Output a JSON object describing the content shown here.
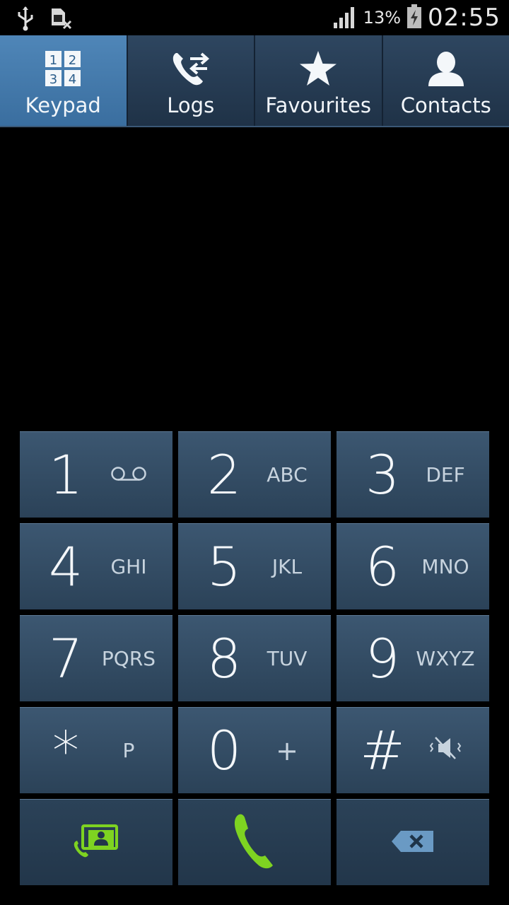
{
  "status_bar": {
    "battery": "13%",
    "time": "02:55",
    "icons": [
      "usb-icon",
      "sim-missing-icon",
      "signal-icon",
      "battery-charging-icon"
    ]
  },
  "tabs": [
    {
      "label": "Keypad",
      "icon": "keypad-icon",
      "active": true
    },
    {
      "label": "Logs",
      "icon": "call-logs-icon",
      "active": false
    },
    {
      "label": "Favourites",
      "icon": "star-icon",
      "active": false
    },
    {
      "label": "Contacts",
      "icon": "contact-icon",
      "active": false
    }
  ],
  "keypad_icon_digits": [
    "1",
    "2",
    "3",
    "4"
  ],
  "keys": [
    {
      "digit": "1",
      "letters": "",
      "icon": "voicemail-icon"
    },
    {
      "digit": "2",
      "letters": "ABC"
    },
    {
      "digit": "3",
      "letters": "DEF"
    },
    {
      "digit": "4",
      "letters": "GHI"
    },
    {
      "digit": "5",
      "letters": "JKL"
    },
    {
      "digit": "6",
      "letters": "MNO"
    },
    {
      "digit": "7",
      "letters": "PQRS"
    },
    {
      "digit": "8",
      "letters": "TUV"
    },
    {
      "digit": "9",
      "letters": "WXYZ"
    },
    {
      "digit": "*",
      "letters": "P"
    },
    {
      "digit": "0",
      "letters": "+"
    },
    {
      "digit": "#",
      "letters": "",
      "icon": "mute-icon"
    }
  ],
  "actions": [
    "add-to-contacts-icon",
    "call-icon",
    "backspace-icon"
  ],
  "colors": {
    "accent_green": "#7ed321",
    "tab_active": "#4a80b3",
    "key_bg": "#344e67"
  }
}
